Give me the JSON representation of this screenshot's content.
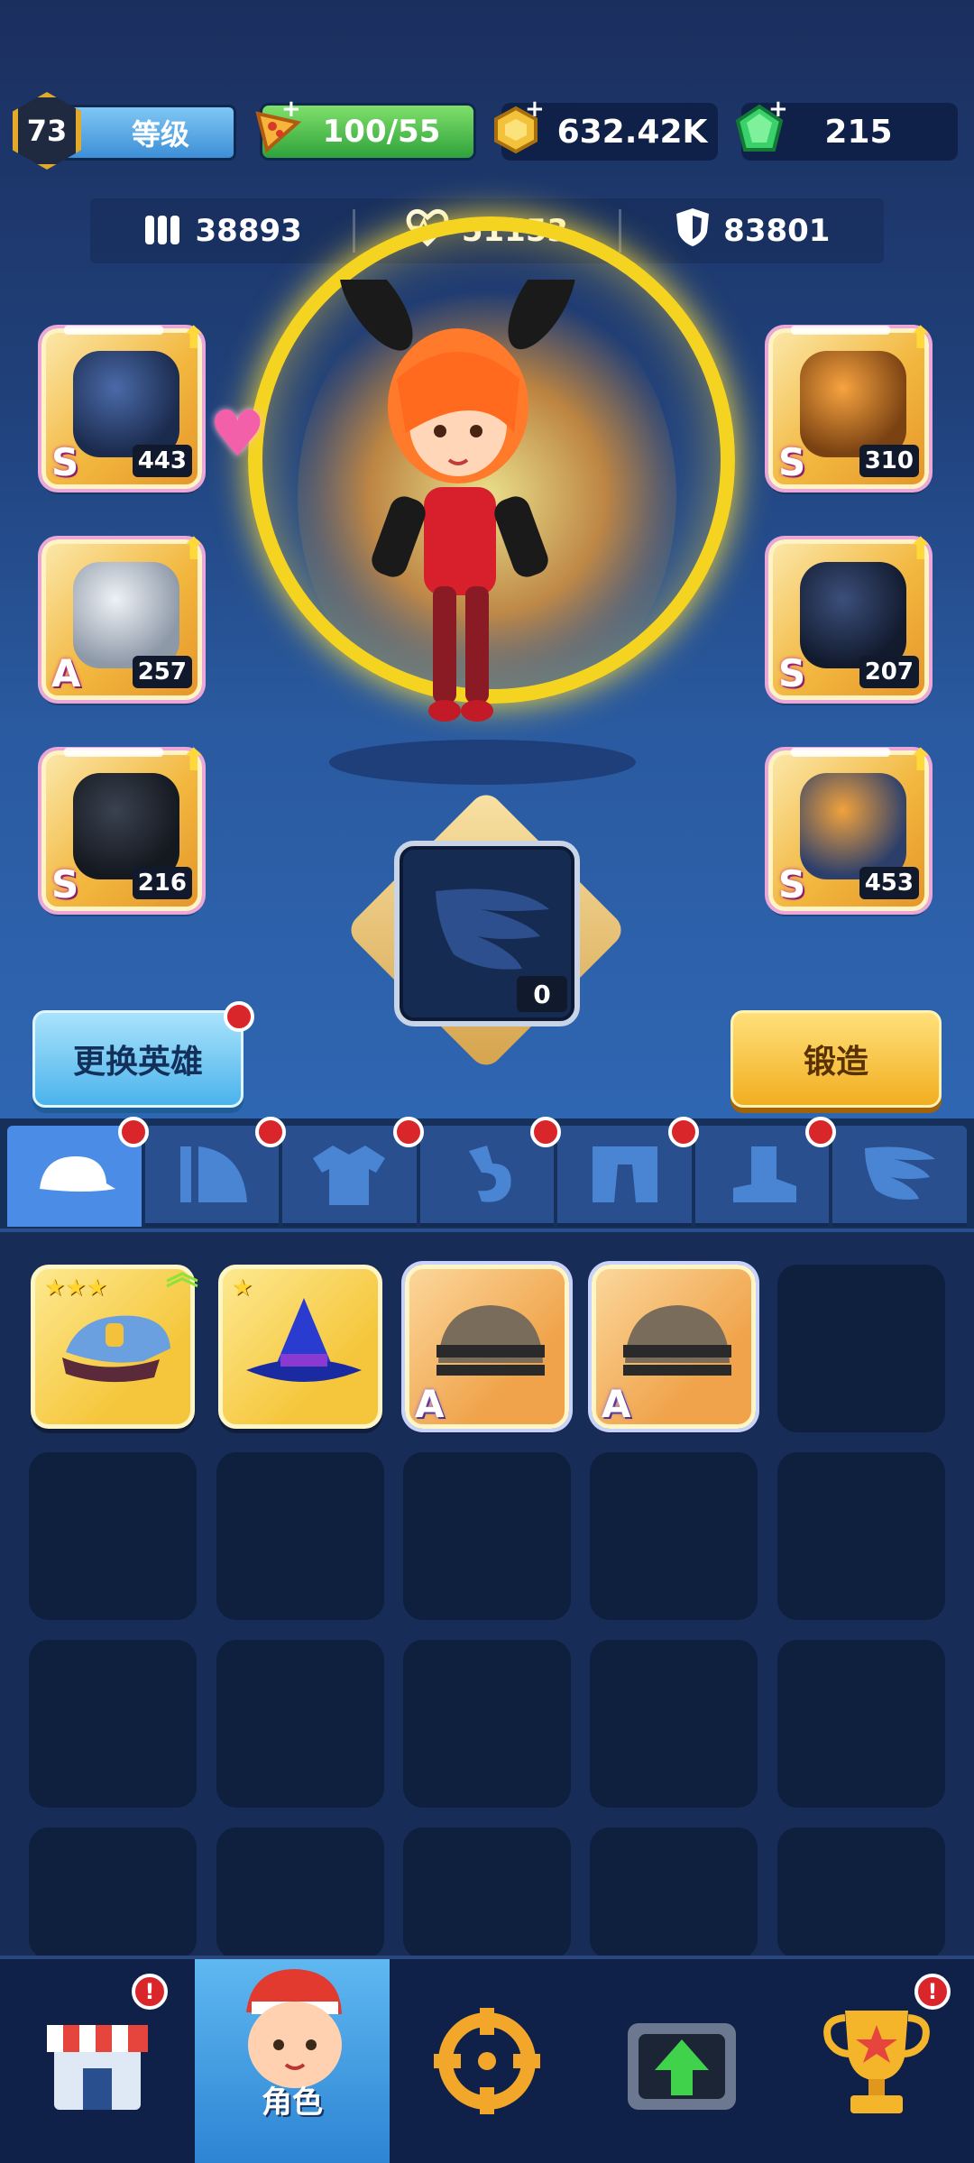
{
  "header": {
    "level": "73",
    "level_label": "等级",
    "energy": "100/55",
    "gold": "632.42K",
    "gems": "215"
  },
  "stats": {
    "attack": "38893",
    "health": "51153",
    "defense": "83801"
  },
  "equipment": {
    "left": [
      {
        "name": "helmet",
        "grade": "S",
        "level": "443"
      },
      {
        "name": "mask",
        "grade": "A",
        "level": "257"
      },
      {
        "name": "belt",
        "grade": "S",
        "level": "216"
      }
    ],
    "right": [
      {
        "name": "shoulder-armor",
        "grade": "S",
        "level": "310"
      },
      {
        "name": "gauntlet",
        "grade": "S",
        "level": "207"
      },
      {
        "name": "boots",
        "grade": "S",
        "level": "453"
      }
    ],
    "wings_level": "0"
  },
  "buttons": {
    "change_hero": "更换英雄",
    "forge": "锻造"
  },
  "tabs": [
    "hat",
    "cape",
    "shirt",
    "glove",
    "pants",
    "boots",
    "wings"
  ],
  "inventory": [
    {
      "name": "police-cap",
      "stars": "★★★",
      "grade": ""
    },
    {
      "name": "wizard-hat",
      "stars": "★",
      "grade": ""
    },
    {
      "name": "steel-helmet",
      "stars": "",
      "grade": "A"
    },
    {
      "name": "steel-helmet",
      "stars": "",
      "grade": "A"
    }
  ],
  "nav": {
    "character_label": "角色"
  },
  "colors": {
    "gold_frame": "#f2b73e",
    "active_tab": "#4b8de6",
    "alert_red": "#d8262a"
  }
}
